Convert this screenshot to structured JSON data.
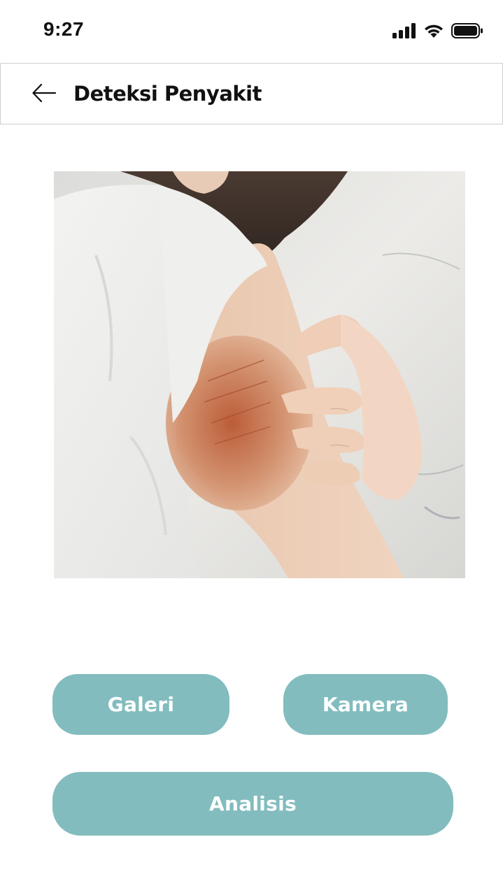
{
  "status_bar": {
    "time": "9:27",
    "icons": [
      "signal-icon",
      "wifi-icon",
      "battery-icon"
    ]
  },
  "header": {
    "back_icon": "arrow-left-icon",
    "title": "Deteksi Penyakit"
  },
  "preview": {
    "image_subject": "person scratching reddened upper arm"
  },
  "actions": {
    "gallery_label": "Galeri",
    "camera_label": "Kamera",
    "analyze_label": "Analisis"
  },
  "colors": {
    "button_bg": "#82bcbe",
    "button_text": "#ffffff",
    "header_border": "#cfcfcf",
    "title_text": "#111111"
  }
}
